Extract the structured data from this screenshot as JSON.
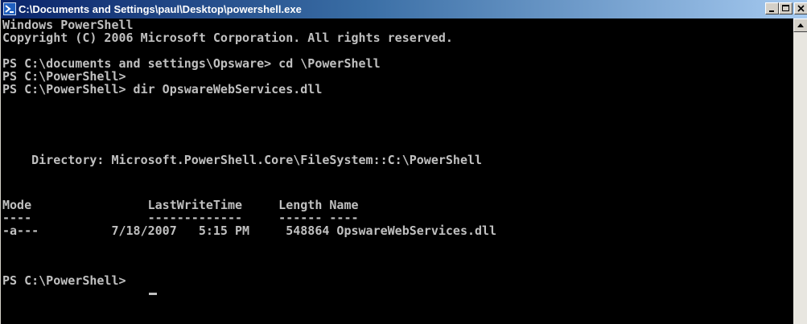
{
  "window": {
    "title": "C:\\Documents and Settings\\paul\\Desktop\\powershell.exe",
    "icon": "powershell-icon",
    "caption_buttons": [
      "minimize",
      "maximize",
      "close"
    ]
  },
  "console": {
    "lines": [
      "Windows PowerShell",
      "Copyright (C) 2006 Microsoft Corporation. All rights reserved.",
      "",
      "PS C:\\documents and settings\\Opsware> cd \\PowerShell",
      "PS C:\\PowerShell>",
      "PS C:\\PowerShell> dir OpswareWebServices.dll",
      "",
      "",
      "    Directory: Microsoft.PowerShell.Core\\FileSystem::C:\\PowerShell",
      "",
      "",
      "Mode                LastWriteTime     Length Name",
      "----                -------------     ------ ----",
      "-a---          7/18/2007   5:15 PM     548864 OpswareWebServices.dll",
      "",
      "",
      "PS C:\\PowerShell> "
    ]
  },
  "colors": {
    "console_background": "#000000",
    "console_text": "#c0c0c0",
    "titlebar_start": "#0a246a",
    "titlebar_end": "#a6caf0"
  }
}
